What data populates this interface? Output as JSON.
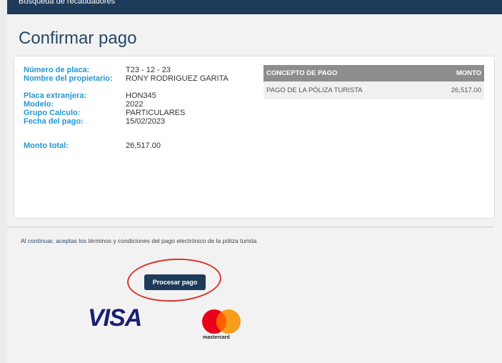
{
  "header": {
    "nav_label": "Busqueda de recaudadores"
  },
  "page": {
    "title": "Confirmar pago"
  },
  "details": {
    "plate_label": "Número de placa:",
    "plate_value": "T23 - 12 - 23",
    "owner_label": "Nombre del propietario:",
    "owner_value": "RONY RODRIGUEZ GARITA",
    "foreign_plate_label": "Placa extranjera:",
    "foreign_plate_value": "HON345",
    "model_label": "Modelo:",
    "model_value": "2022",
    "group_label": "Grupo Calculo:",
    "group_value": "PARTICULARES",
    "date_label": "Fecha del pago:",
    "date_value": "15/02/2023",
    "total_label": "Monto total:",
    "total_value": "26,517.00"
  },
  "concept_table": {
    "headers": [
      "CONCEPTO DE PAGO",
      "MONTO"
    ],
    "rows": [
      {
        "concept": "PAGO DE LA PÓLIZA TURISTA",
        "amount": "26,517.00"
      }
    ]
  },
  "terms": {
    "prefix": "Al continuar,",
    "accept": "aceptas los",
    "rest": "términos y condiciones del pago electrónico de la póliza turista"
  },
  "actions": {
    "process_label": "Procesar pago"
  },
  "payment_logos": {
    "visa": "VISA",
    "mastercard": "mastercard"
  },
  "colors": {
    "primary": "#1f3b5a",
    "label_blue": "#2596d2",
    "highlight_red": "#d9342b"
  }
}
